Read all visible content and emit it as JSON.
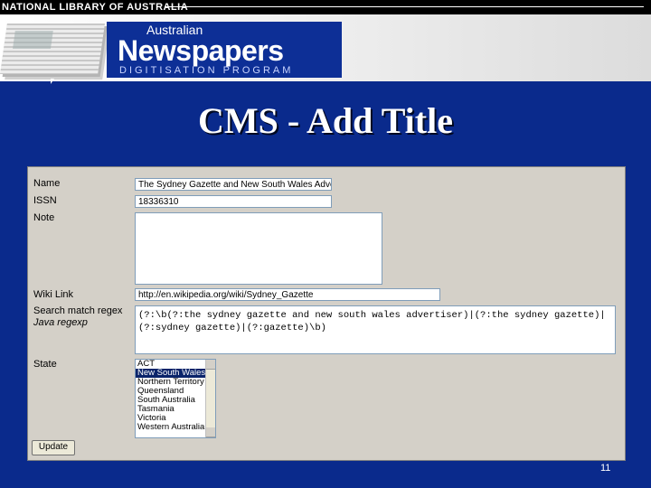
{
  "header": {
    "org": "NATIONAL LIBRARY OF AUSTRALIA",
    "brand_small": "Australian",
    "brand_big": "Newspapers",
    "brand_sub": "DIGITISATION PROGRAM"
  },
  "slide": {
    "title": "CMS - Add Title",
    "page_number": "11"
  },
  "form": {
    "name_label": "Name",
    "name_value": "The Sydney Gazette and New South Wales Advertiser",
    "issn_label": "ISSN",
    "issn_value": "18336310",
    "note_label": "Note",
    "note_value": "",
    "wiki_label": "Wiki Link",
    "wiki_value": "http://en.wikipedia.org/wiki/Sydney_Gazette",
    "regex_label": "Search match regex",
    "regex_sublabel": "Java regexp",
    "regex_value": "(?:\\b(?:the sydney gazette and new south wales advertiser)|(?:the sydney gazette)|(?:sydney gazette)|(?:gazette)\\b)",
    "state_label": "State",
    "state_options": [
      "ACT",
      "New South Wales",
      "Northern Territory",
      "Queensland",
      "South Australia",
      "Tasmania",
      "Victoria",
      "Western Australia"
    ],
    "state_selected": "New South Wales",
    "update_label": "Update"
  }
}
